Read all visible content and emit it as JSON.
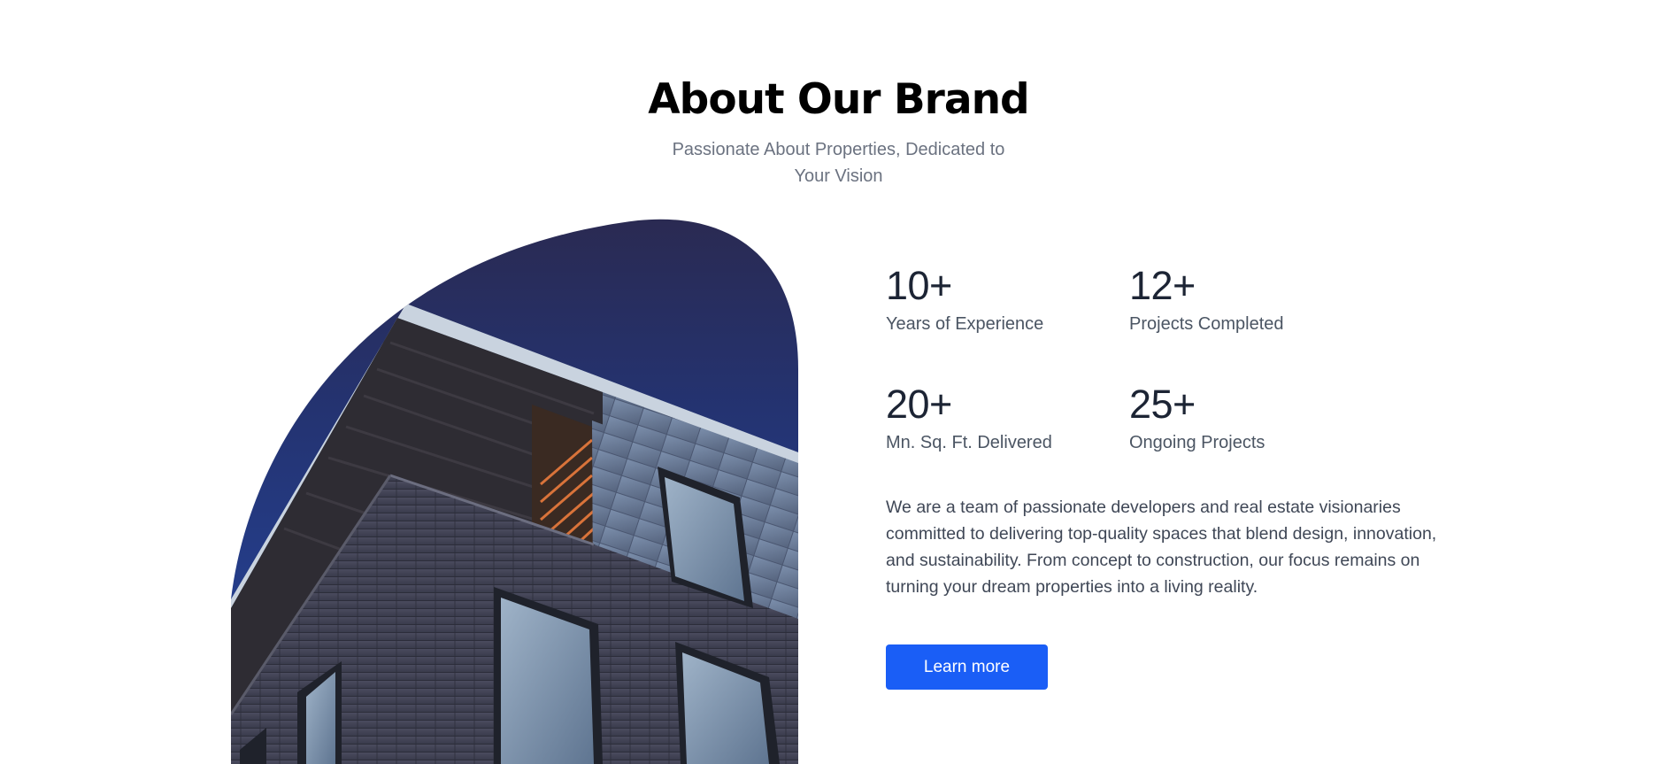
{
  "header": {
    "title": "About Our Brand",
    "subtitle": "Passionate About Properties, Dedicated to Your Vision"
  },
  "stats": [
    {
      "value": "10+",
      "label": "Years of Experience"
    },
    {
      "value": "12+",
      "label": "Projects Completed"
    },
    {
      "value": "20+",
      "label": "Mn. Sq. Ft. Delivered"
    },
    {
      "value": "25+",
      "label": "Ongoing Projects"
    }
  ],
  "description": "We are a team of passionate developers and real estate visionaries committed to delivering top-quality spaces that blend design, innovation, and sustainability. From concept to construction, our focus remains on turning your dream properties into a living reality.",
  "cta": {
    "label": "Learn more"
  },
  "colors": {
    "accent": "#1a5ef6",
    "sky_top": "#2a2a52",
    "sky_bottom": "#2446a0"
  }
}
